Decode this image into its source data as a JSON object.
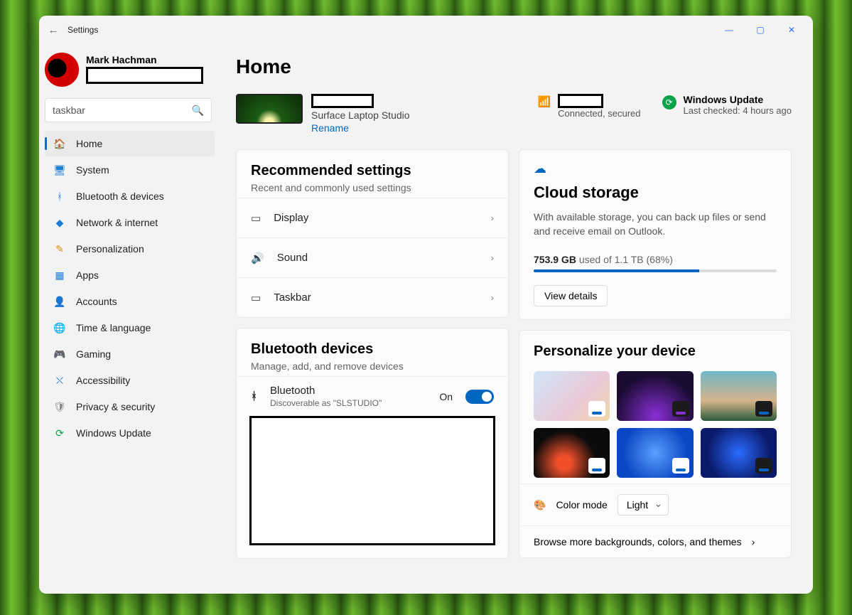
{
  "window": {
    "app_title": "Settings"
  },
  "user": {
    "name": "Mark Hachman"
  },
  "search": {
    "value": "taskbar"
  },
  "nav": [
    {
      "label": "Home",
      "icon": "🏠",
      "color": "#d98b12",
      "active": true
    },
    {
      "label": "System",
      "icon": "🖥",
      "color": "#1b7ed6"
    },
    {
      "label": "Bluetooth & devices",
      "icon": "ᚼ",
      "color": "#1b7ed6"
    },
    {
      "label": "Network & internet",
      "icon": "◆",
      "color": "#1b7ed6"
    },
    {
      "label": "Personalization",
      "icon": "✎",
      "color": "#d98b12"
    },
    {
      "label": "Apps",
      "icon": "▦",
      "color": "#1b7ed6"
    },
    {
      "label": "Accounts",
      "icon": "👤",
      "color": "#0aa34a"
    },
    {
      "label": "Time & language",
      "icon": "🌐",
      "color": "#1b7ed6"
    },
    {
      "label": "Gaming",
      "icon": "🎮",
      "color": "#777"
    },
    {
      "label": "Accessibility",
      "icon": "⛌",
      "color": "#1b7ed6"
    },
    {
      "label": "Privacy & security",
      "icon": "🛡",
      "color": "#888"
    },
    {
      "label": "Windows Update",
      "icon": "⟳",
      "color": "#0aa34a"
    }
  ],
  "page": {
    "title": "Home"
  },
  "device": {
    "model": "Surface Laptop Studio",
    "rename": "Rename"
  },
  "wifi": {
    "status": "Connected, secured"
  },
  "windows_update": {
    "title": "Windows Update",
    "subtitle": "Last checked: 4 hours ago"
  },
  "recommended": {
    "title": "Recommended settings",
    "subtitle": "Recent and commonly used settings",
    "items": [
      {
        "label": "Display",
        "icon": "▭"
      },
      {
        "label": "Sound",
        "icon": "🔊"
      },
      {
        "label": "Taskbar",
        "icon": "▭"
      }
    ]
  },
  "bluetooth": {
    "title": "Bluetooth devices",
    "subtitle": "Manage, add, and remove devices",
    "name": "Bluetooth",
    "discoverable": "Discoverable as \"SLSTUDIO\"",
    "state": "On"
  },
  "cloud": {
    "title": "Cloud storage",
    "desc": "With available storage, you can back up files or send and receive email on Outlook.",
    "used_value": "753.9 GB",
    "used_tail": " used of 1.1 TB (68%)",
    "percent": 68,
    "view": "View details"
  },
  "personalize": {
    "title": "Personalize your device",
    "color_mode_label": "Color mode",
    "color_mode_value": "Light",
    "browse": "Browse more backgrounds, colors, and themes"
  }
}
